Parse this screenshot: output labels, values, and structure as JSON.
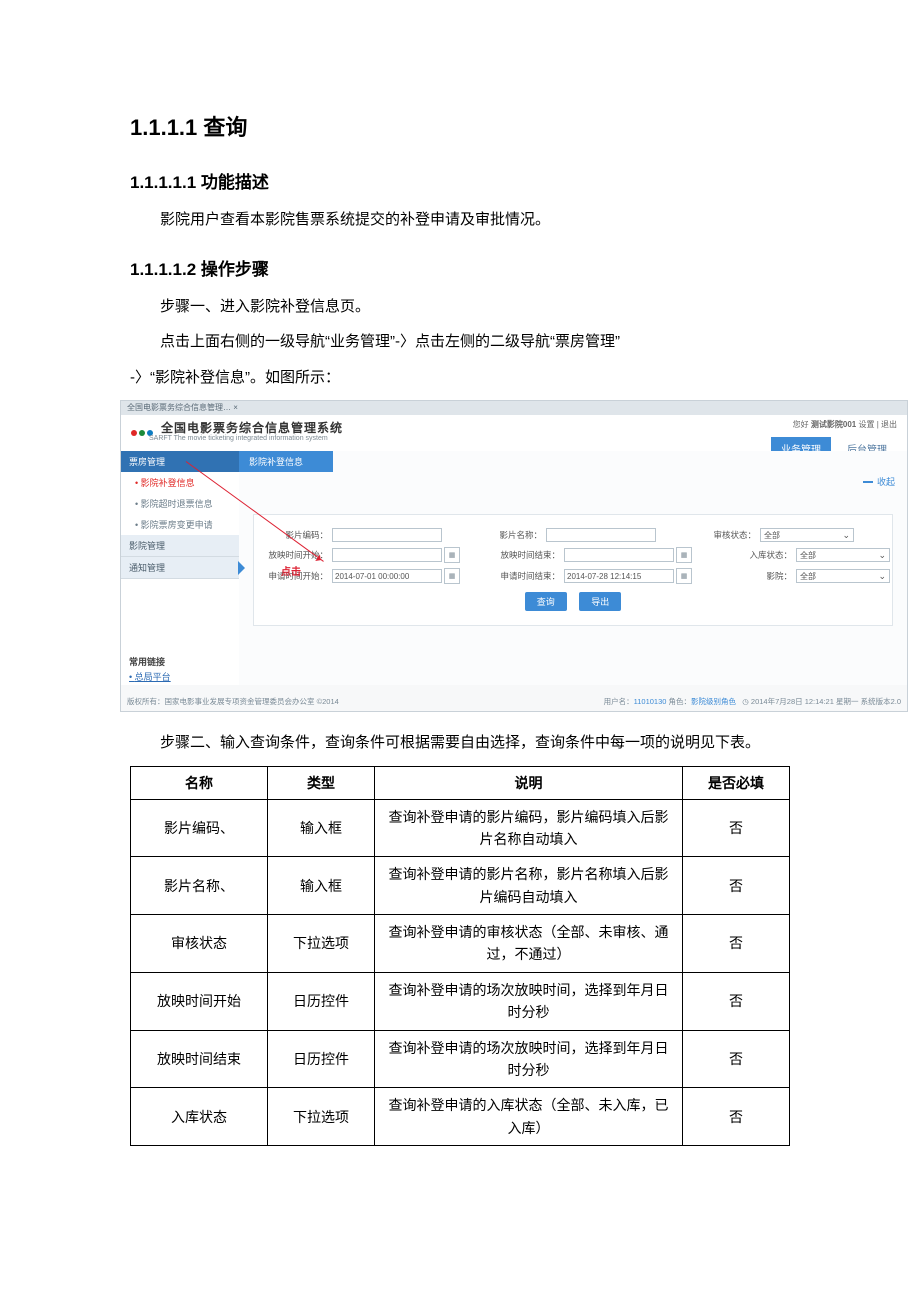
{
  "headings": {
    "h1": "1.1.1.1 查询",
    "h2a": "1.1.1.1.1 功能描述",
    "h2b": "1.1.1.1.2 操作步骤"
  },
  "paragraphs": {
    "p1": "影院用户查看本影院售票系统提交的补登申请及审批情况。",
    "p2": "步骤一、进入影院补登信息页。",
    "p3a": "点击上面右侧的一级导航“业务管理”-〉点击左侧的二级导航“票房管理”",
    "p3b": "-〉“影院补登信息”。如图所示：",
    "p4": "步骤二、输入查询条件，查询条件可根据需要自由选择，查询条件中每一项的说明见下表。"
  },
  "shot": {
    "tab": "全国电影票务综合信息管理… ×",
    "logo_title": "全国电影票务综合信息管理系统",
    "logo_sub": "SARFT The movie ticketing integrated information system",
    "userline_prefix": "您好",
    "userline_user": "测试影院001",
    "userline_links": "设置 | 退出",
    "topnav": {
      "biz": "业务管理",
      "admin": "后台管理"
    },
    "sidebar": {
      "sec_boxoffice": "票房管理",
      "item_supp": "影院补登信息",
      "item_refund": "影院超时退票信息",
      "item_change": "影院票房变更申请",
      "sec_cinema": "影院管理",
      "sec_notice": "通知管理",
      "common_title": "常用链接",
      "common_link": "总局平台"
    },
    "crumb": "影院补登信息",
    "collapse": "收起",
    "arrow_note": "点击",
    "form": {
      "film_code": "影片编码：",
      "film_name": "影片名称：",
      "audit_status": "审核状态：",
      "show_start": "放映时间开始：",
      "show_end": "放映时间结束：",
      "store_status": "入库状态：",
      "apply_start": "申请时间开始：",
      "apply_end": "申请时间结束：",
      "cinema": "影院：",
      "sel_all": "全部",
      "val_apply_start": "2014-07-01 00:00:00",
      "val_apply_end": "2014-07-28 12:14:15",
      "btn_query": "查询",
      "btn_export": "导出"
    },
    "footer": {
      "left": "版权所有：国家电影事业发展专项资金管理委员会办公室 ©2014",
      "user_label": "用户名：",
      "user": "11010130",
      "role_label": " 角色：",
      "role": "影院级别角色",
      "time": "2014年7月28日 12:14:21 星期一  系统版本2.0"
    }
  },
  "table": {
    "headers": {
      "name": "名称",
      "type": "类型",
      "desc": "说明",
      "required": "是否必填"
    },
    "rows": [
      {
        "name": "影片编码、",
        "type": "输入框",
        "desc": "查询补登申请的影片编码，影片编码填入后影片名称自动填入",
        "required": "否"
      },
      {
        "name": "影片名称、",
        "type": "输入框",
        "desc": "查询补登申请的影片名称，影片名称填入后影片编码自动填入",
        "required": "否"
      },
      {
        "name": "审核状态",
        "type": "下拉选项",
        "desc": "查询补登申请的审核状态（全部、未审核、通过，不通过）",
        "required": "否"
      },
      {
        "name": "放映时间开始",
        "type": "日历控件",
        "desc": "查询补登申请的场次放映时间，选择到年月日时分秒",
        "required": "否"
      },
      {
        "name": "放映时间结束",
        "type": "日历控件",
        "desc": "查询补登申请的场次放映时间，选择到年月日时分秒",
        "required": "否"
      },
      {
        "name": "入库状态",
        "type": "下拉选项",
        "desc": "查询补登申请的入库状态（全部、未入库，已入库）",
        "required": "否"
      }
    ]
  }
}
